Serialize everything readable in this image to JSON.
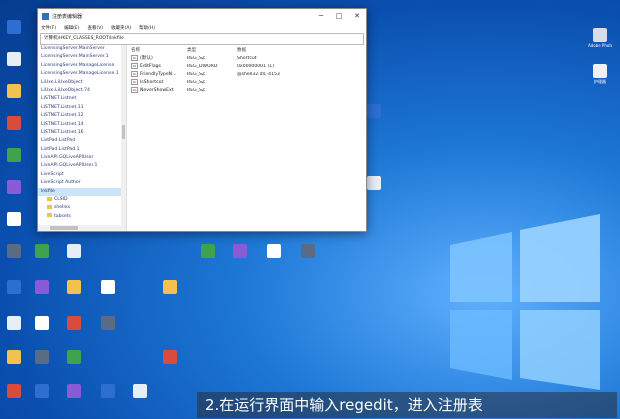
{
  "window": {
    "title": "注册表编辑器",
    "menu": [
      "文件(F)",
      "编辑(E)",
      "查看(V)",
      "收藏夹(A)",
      "帮助(H)"
    ],
    "address": "计算机\\HKEY_CLASSES_ROOT\\lnkfile",
    "tree_items": [
      {
        "label": "LicensingServer.MainServer",
        "selected": false,
        "child": false
      },
      {
        "label": "LicensingServer.MainServer.1",
        "selected": false,
        "child": false
      },
      {
        "label": "LicensingServer.ManageLicense",
        "selected": false,
        "child": false
      },
      {
        "label": "LicensingServer.ManageLicense.1",
        "selected": false,
        "child": false
      },
      {
        "label": "LiUxe.LiUxeObject",
        "selected": false,
        "child": false
      },
      {
        "label": "LiUxe.LiUxeObject.74",
        "selected": false,
        "child": false
      },
      {
        "label": "LISTNET.Listnet",
        "selected": false,
        "child": false
      },
      {
        "label": "LISTNET.Listnet.11",
        "selected": false,
        "child": false
      },
      {
        "label": "LISTNET.Listnet.12",
        "selected": false,
        "child": false
      },
      {
        "label": "LISTNET.Listnet.14",
        "selected": false,
        "child": false
      },
      {
        "label": "LISTNET.Listnet.16",
        "selected": false,
        "child": false
      },
      {
        "label": "ListPad.ListPad",
        "selected": false,
        "child": false
      },
      {
        "label": "ListPad.ListPad.1",
        "selected": false,
        "child": false
      },
      {
        "label": "LiveAPI.GQLiveAPIUser",
        "selected": false,
        "child": false
      },
      {
        "label": "LiveAPI.GQLiveAPIUser.1",
        "selected": false,
        "child": false
      },
      {
        "label": "LiveScript",
        "selected": false,
        "child": false
      },
      {
        "label": "LiveScript Author",
        "selected": false,
        "child": false
      },
      {
        "label": "lnkfile",
        "selected": true,
        "child": false
      },
      {
        "label": "CLSID",
        "selected": false,
        "child": true
      },
      {
        "label": "shellex",
        "selected": false,
        "child": true
      },
      {
        "label": "tabsets",
        "selected": false,
        "child": true
      }
    ],
    "columns": [
      "名称",
      "类型",
      "数据"
    ],
    "values": [
      {
        "name": "(默认)",
        "type": "REG_SZ",
        "data": "Shortcut",
        "kind": "str"
      },
      {
        "name": "EditFlags",
        "type": "REG_DWORD",
        "data": "0x00000001 (1)",
        "kind": "bin"
      },
      {
        "name": "FriendlyTypeN...",
        "type": "REG_SZ",
        "data": "@shell32.dll,-4153",
        "kind": "str"
      },
      {
        "name": "IsShortcut",
        "type": "REG_SZ",
        "data": "",
        "kind": "str"
      },
      {
        "name": "NeverShowExt",
        "type": "REG_SZ",
        "data": "",
        "kind": "str"
      }
    ]
  },
  "desktop_icons_right": [
    {
      "label": "Adobe Photosh...",
      "color": "#cfd8e8"
    },
    {
      "label": "护理器",
      "color": "#e8edf5"
    }
  ],
  "caption": "2.在运行界面中输入regedit，进入注册表",
  "colors": {
    "accent": "#1e78d6",
    "selection": "#cce4f7"
  }
}
